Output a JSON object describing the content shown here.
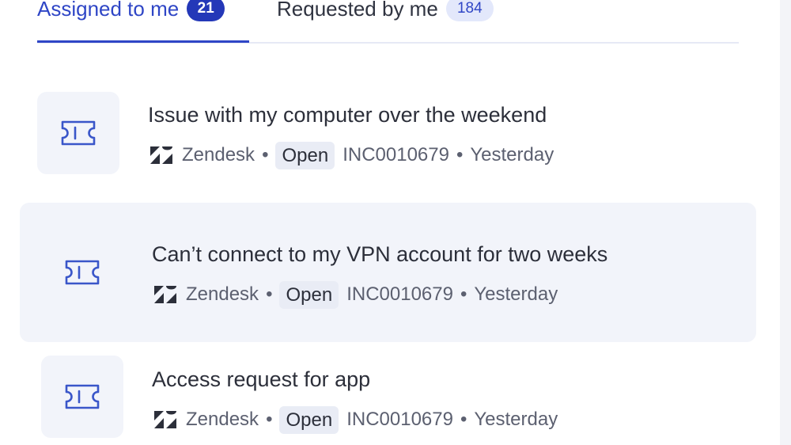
{
  "tabs": [
    {
      "label": "Assigned to me",
      "count": "21",
      "active": true
    },
    {
      "label": "Requested by me",
      "count": "184",
      "active": false
    }
  ],
  "tickets": [
    {
      "title": "Issue with my computer over the weekend",
      "source": "Zendesk",
      "separator": "•",
      "status": "Open",
      "id": "INC0010679",
      "time": "Yesterday",
      "selected": false
    },
    {
      "title": "Can’t connect to my VPN account for two weeks",
      "source": "Zendesk",
      "separator": "•",
      "status": "Open",
      "id": "INC0010679",
      "time": "Yesterday",
      "selected": true
    },
    {
      "title": "Access request for app",
      "source": "Zendesk",
      "separator": "•",
      "status": "Open",
      "id": "INC0010679",
      "time": "Yesterday",
      "selected": false
    }
  ],
  "icons": {
    "ticket": "ticket-icon",
    "source": "zendesk-logo-icon"
  },
  "colors": {
    "accent": "#2f46c6",
    "badge_active_bg": "#2438b8",
    "badge_inactive_bg": "#e3e8fb",
    "selected_row_bg": "#f2f4fa",
    "icon_box_bg": "#f2f4fa",
    "status_bg": "#e9ecf5",
    "icon_stroke": "#3a56c9"
  }
}
